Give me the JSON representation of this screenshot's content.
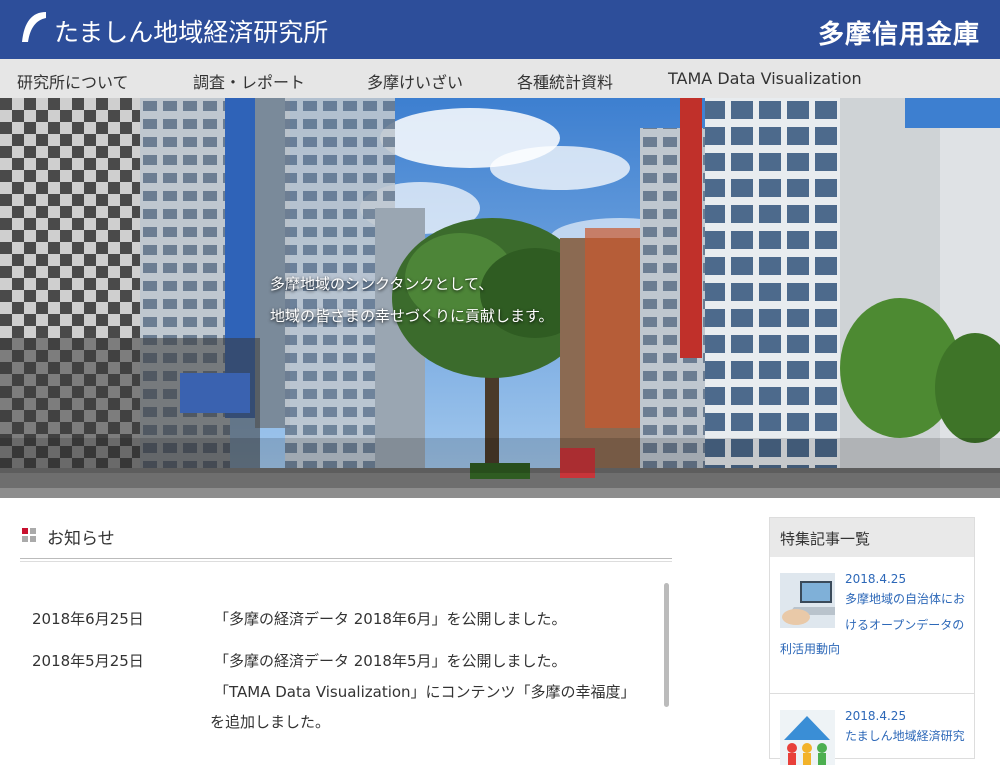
{
  "header": {
    "site_title": "たましん地域経済研究所",
    "bank_name": "多摩信用金庫"
  },
  "nav": {
    "items": [
      "研究所について",
      "調査・レポート",
      "多摩けいざい",
      "各種統計資料",
      "TAMA Data Visualization"
    ]
  },
  "hero": {
    "line1": "多摩地域のシンクタンクとして、",
    "line2": "地域の皆さまの幸せづくりに貢献します。"
  },
  "news": {
    "title": "お知らせ",
    "items": [
      {
        "date": "2018年6月25日",
        "lines": [
          "「多摩の経済データ 2018年6月」を公開しました。"
        ]
      },
      {
        "date": "2018年5月25日",
        "lines": [
          "「多摩の経済データ 2018年5月」を公開しました。",
          "「TAMA Data Visualization」にコンテンツ「多摩の幸福度」",
          "を追加しました。"
        ]
      }
    ]
  },
  "sidebar": {
    "title": "特集記事一覧",
    "items": [
      {
        "date": "2018.4.25",
        "lines": [
          "多摩地域の自治体にお",
          "けるオープンデータの",
          "利活用動向"
        ]
      },
      {
        "date": "2018.4.25",
        "lines": [
          "たましん地域経済研究"
        ]
      }
    ]
  },
  "colors": {
    "header_bg": "#2d4e9a",
    "nav_bg": "#e6e6e6",
    "link": "#2d68b8",
    "accent_red": "#c8102e"
  }
}
